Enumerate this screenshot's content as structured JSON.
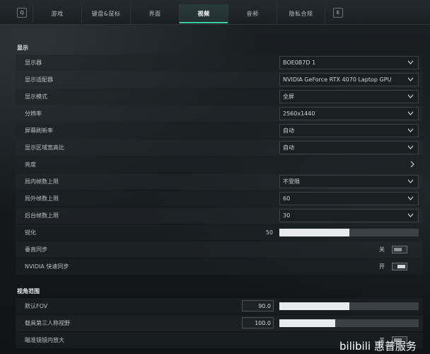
{
  "tabbar": {
    "left_key": "Q",
    "right_key": "E",
    "tabs": [
      {
        "label": "游戏"
      },
      {
        "label": "键盘&鼠标"
      },
      {
        "label": "界面"
      },
      {
        "label": "视频",
        "active": true
      },
      {
        "label": "音频"
      },
      {
        "label": "隐私合规"
      }
    ]
  },
  "display_section": {
    "title": "显示",
    "rows": [
      {
        "label": "显示器",
        "value": "BOE0B7D 1"
      },
      {
        "label": "显示适配器",
        "value": "NVIDIA GeForce RTX 4070 Laptop GPU"
      },
      {
        "label": "显示模式",
        "value": "全屏"
      },
      {
        "label": "分辨率",
        "value": "2560x1440"
      },
      {
        "label": "屏幕刷新率",
        "value": "自动"
      },
      {
        "label": "显示区域宽高比",
        "value": "自动"
      },
      {
        "label": "亮度"
      },
      {
        "label": "局内帧数上限",
        "value": "不受限"
      },
      {
        "label": "局外帧数上限",
        "value": "60"
      },
      {
        "label": "后台帧数上限",
        "value": "30"
      },
      {
        "label": "锐化",
        "value": "50",
        "level": 0.5
      },
      {
        "label": "垂直同步",
        "value": "关",
        "on": false
      },
      {
        "label": "NVIDIA 快速同步",
        "value": "开",
        "on": true
      }
    ]
  },
  "fov_section": {
    "title": "视角范围",
    "rows": [
      {
        "label": "默认FOV",
        "value": "90.0",
        "level": 0.5
      },
      {
        "label": "载具第三人称视野",
        "value": "100.0",
        "level": 0.4
      },
      {
        "label": "瞄准镜镜内放大",
        "value": "关",
        "on": false
      }
    ]
  },
  "watermark": "bilibili 惠普服务",
  "colors": {
    "accent": "#3fc9a5",
    "background": "#15191c"
  }
}
